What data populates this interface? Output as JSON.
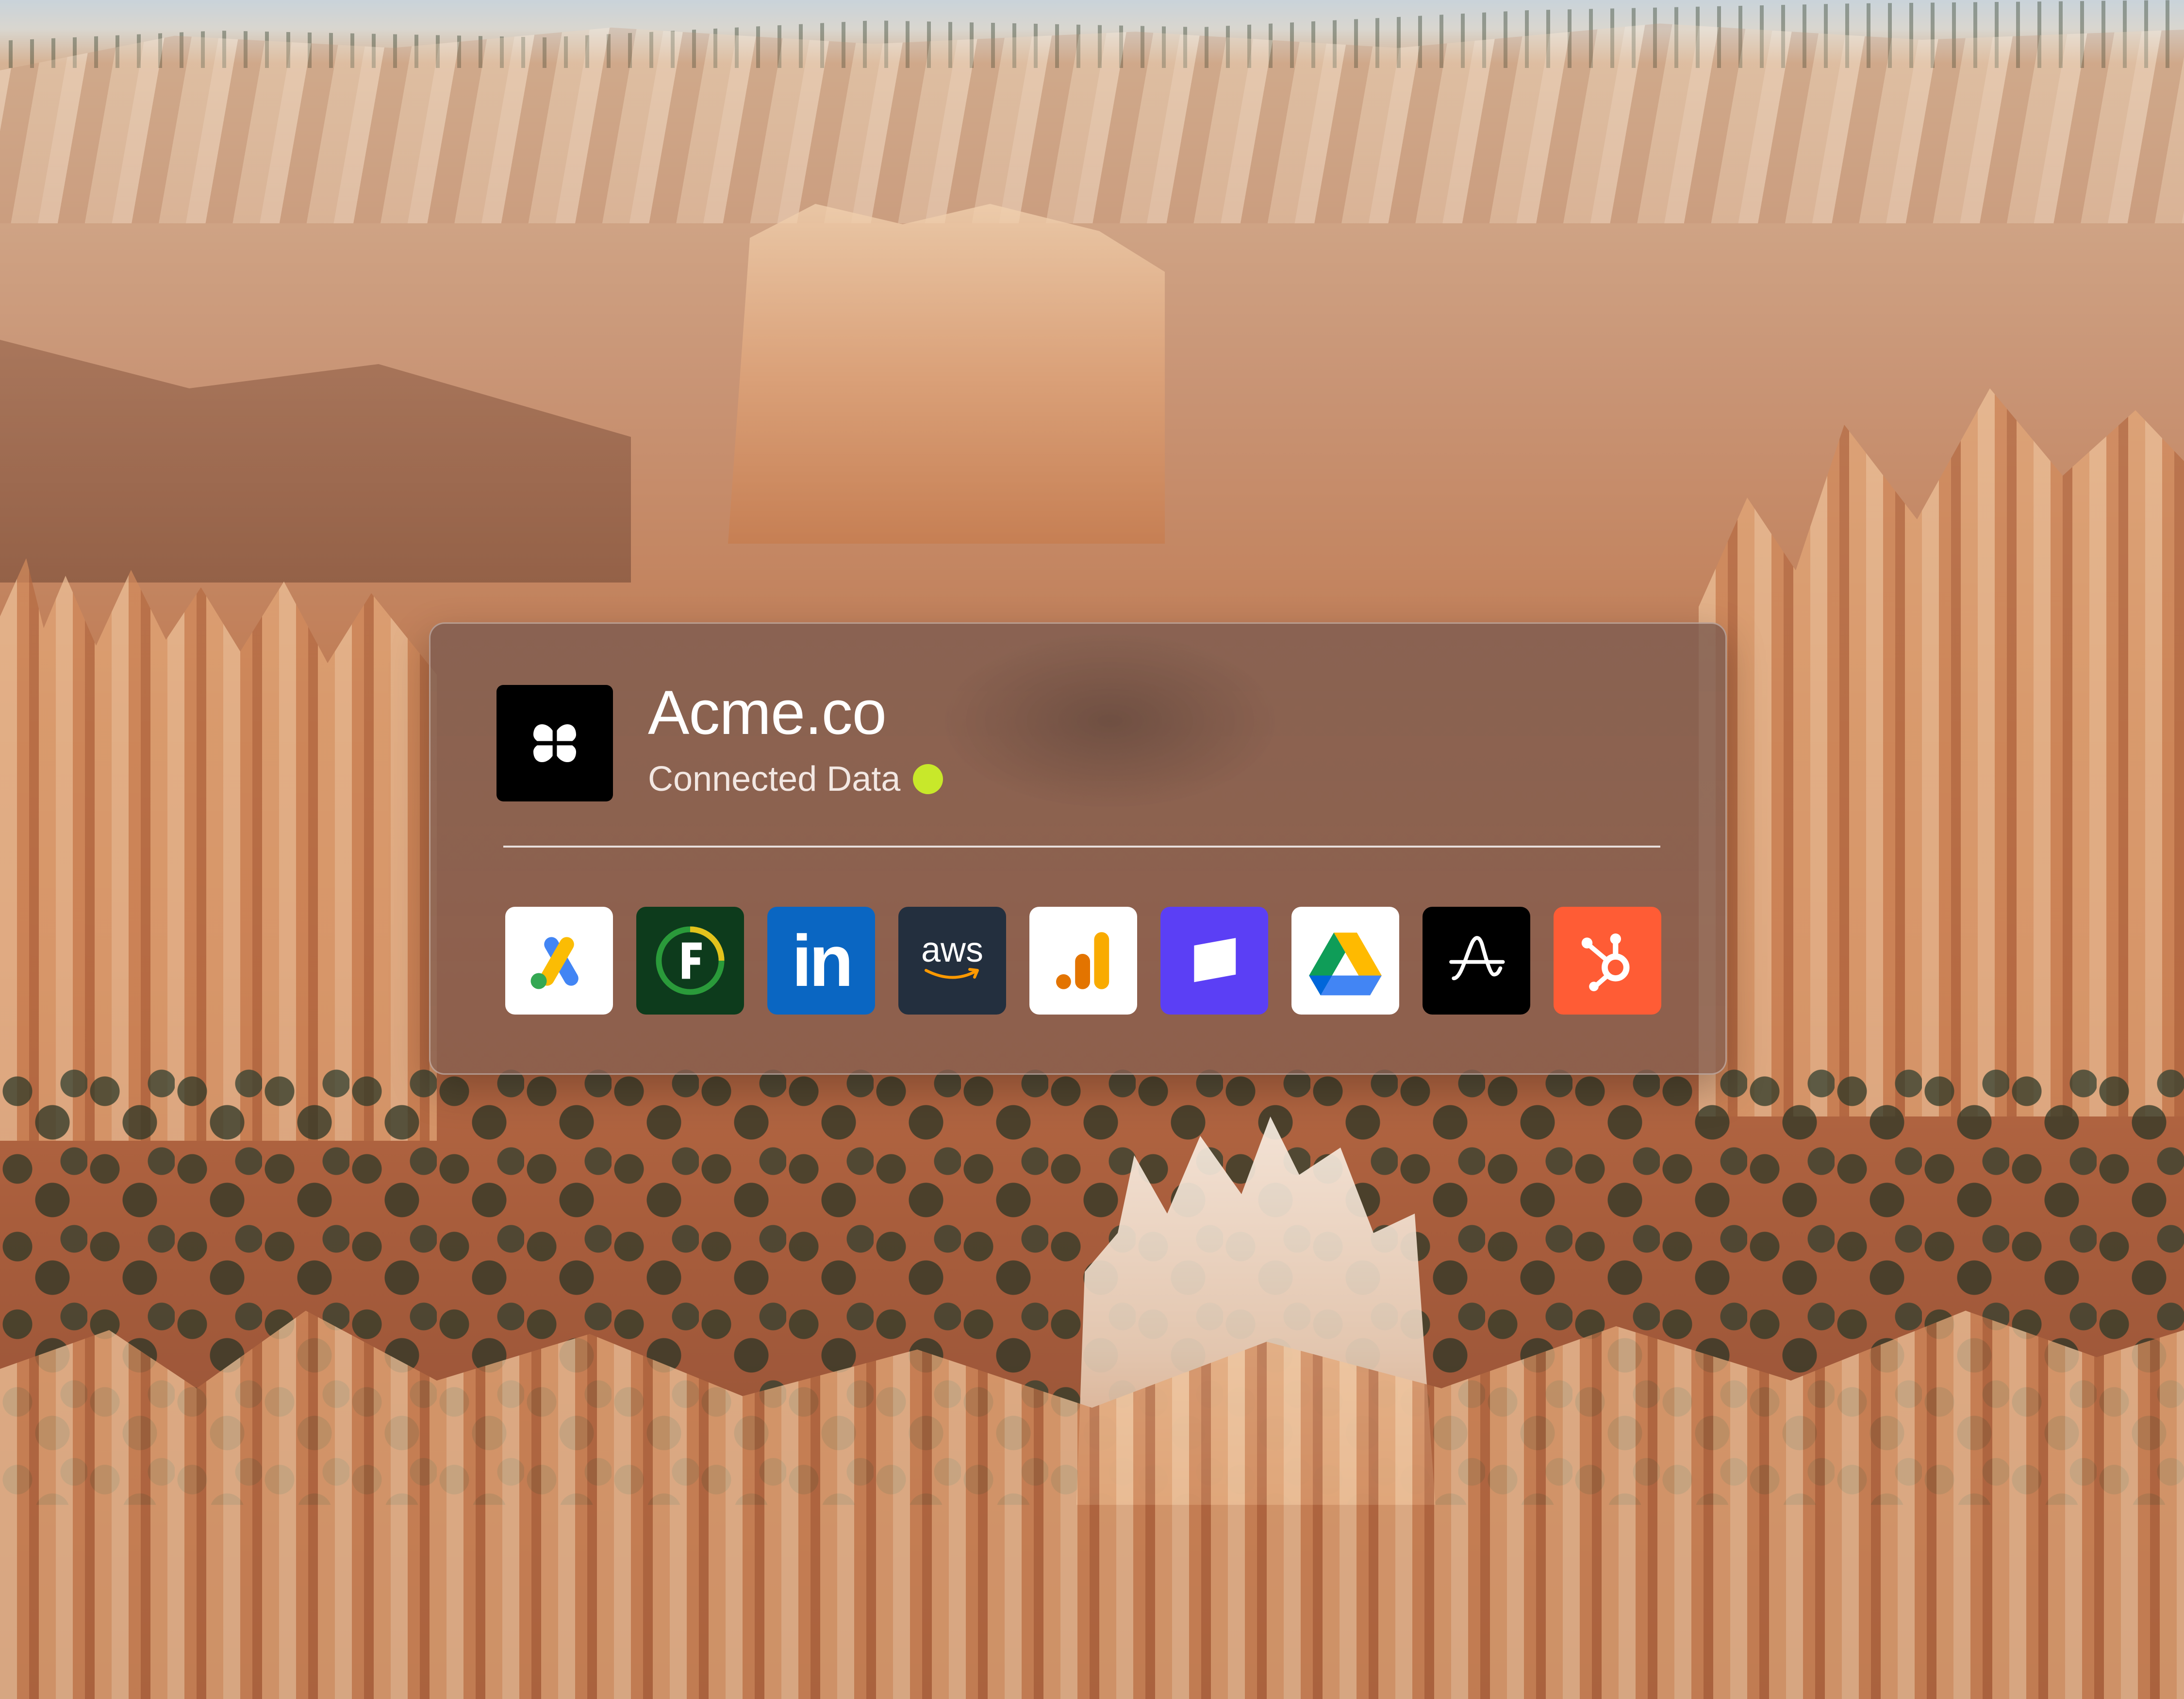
{
  "company": {
    "name": "Acme.co",
    "status_text": "Connected Data",
    "status_color": "#c8e82a"
  },
  "integrations": [
    {
      "icon": "google-ads-icon",
      "bg": "#ffffff"
    },
    {
      "icon": "fathom-icon",
      "bg": "#0d3b1c"
    },
    {
      "icon": "linkedin-icon",
      "bg": "#0a66c2",
      "text": "in"
    },
    {
      "icon": "aws-icon",
      "bg": "#232f3e",
      "text": "aws"
    },
    {
      "icon": "google-analytics-icon",
      "bg": "#ffffff"
    },
    {
      "icon": "flag-app-icon",
      "bg": "#5b3ff5"
    },
    {
      "icon": "google-drive-icon",
      "bg": "#ffffff"
    },
    {
      "icon": "amplitude-icon",
      "bg": "#000000"
    },
    {
      "icon": "hubspot-icon",
      "bg": "#ff5c35"
    }
  ]
}
